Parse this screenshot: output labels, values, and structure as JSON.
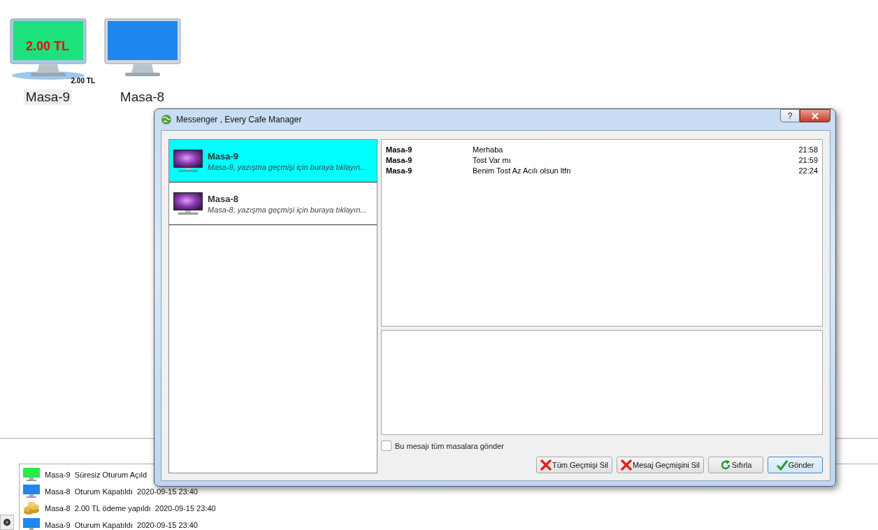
{
  "desktop_icons": [
    {
      "label": "Masa-9",
      "color": "#1ee07c",
      "screen_text": "2.00 TL",
      "badge": "2.00 TL",
      "selected": true
    },
    {
      "label": "Masa-8",
      "color": "#1e88f0",
      "selected": false
    }
  ],
  "log": [
    {
      "kind": "monitor",
      "color": "#22ee44",
      "table": "Masa-9",
      "message": "Süresiz Oturum Açıld"
    },
    {
      "kind": "monitor",
      "color": "#1e88f0",
      "table": "Masa-8",
      "message": "Oturum Kapatıldı",
      "time": "2020-09-15 23:40"
    },
    {
      "kind": "coins",
      "table": "Masa-8",
      "message": "2.00 TL ödeme yapıldı",
      "time": "2020-09-15 23:40"
    },
    {
      "kind": "monitor",
      "color": "#1e88f0",
      "table": "Masa-9",
      "message": "Oturum Kapatıldı",
      "time": "2020-09-15 23:40"
    }
  ],
  "window": {
    "title": "Messenger ,  Every Cafe Manager",
    "help": "?"
  },
  "contacts": [
    {
      "name": "Masa-9",
      "hint": "Masa-9, yazışma geçmişi için buraya tıklayın...",
      "selected": true
    },
    {
      "name": "Masa-8",
      "hint": "Masa-8, yazışma geçmişi için buraya tıklayın...",
      "selected": false
    }
  ],
  "messages": [
    {
      "sender": "Masa-9",
      "text": "Merhaba",
      "time": "21:58"
    },
    {
      "sender": "Masa-9",
      "text": "Tost Var mı",
      "time": "21:59"
    },
    {
      "sender": "Masa-9",
      "text": "Benim Tost Az Acılı olsun ltfn",
      "time": "22:24"
    }
  ],
  "send_to_all": {
    "label": "Bu mesajı tüm masalara gönder",
    "checked": false
  },
  "buttons": [
    {
      "label": "Tüm Geçmişi Sil",
      "kind": "delete"
    },
    {
      "label": "Mesaj Geçmişini Sil",
      "kind": "delete"
    },
    {
      "label": "Sıfırla",
      "kind": "reset"
    },
    {
      "label": "Gönder",
      "kind": "send",
      "selected": true
    }
  ]
}
